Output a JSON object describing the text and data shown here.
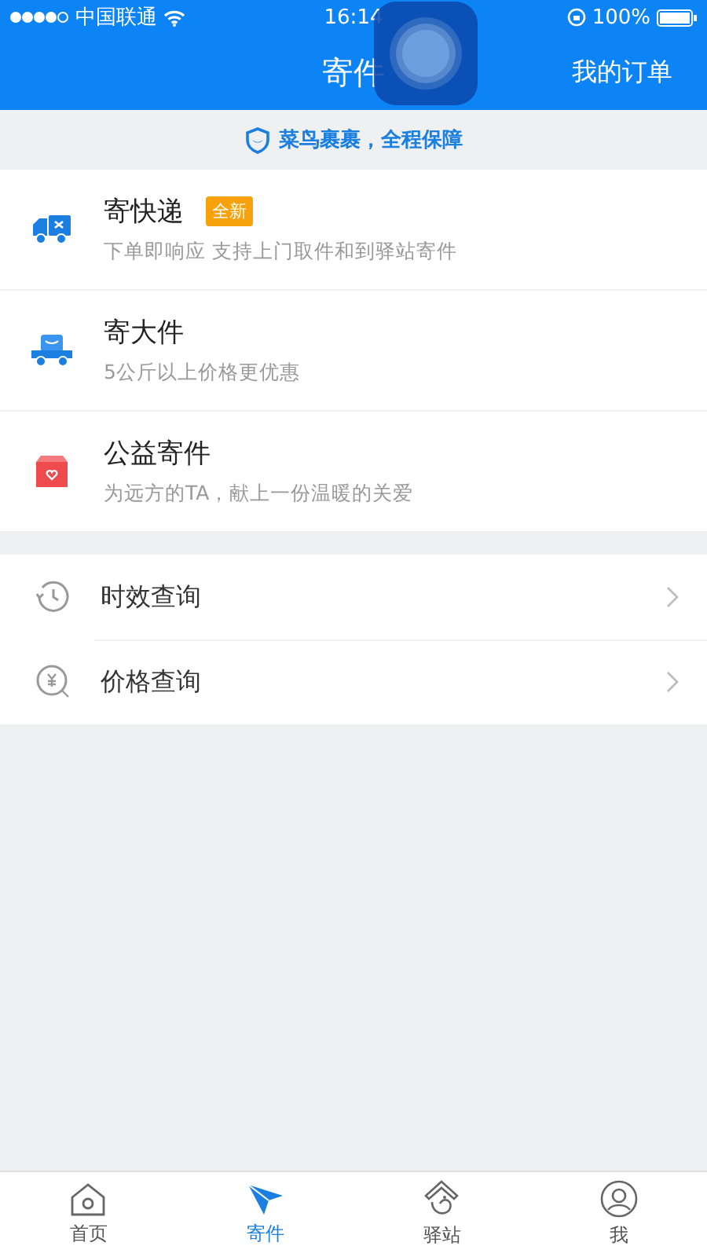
{
  "status_bar": {
    "carrier": "中国联通",
    "time": "16:14",
    "battery": "100%"
  },
  "nav_bar": {
    "title": "寄件",
    "action": "我的订单"
  },
  "banner": {
    "text": "菜鸟裹裹，全程保障"
  },
  "services": [
    {
      "kind": "express",
      "title": "寄快递",
      "badge": "全新",
      "subtitle": "下单即响应 支持上门取件和到驿站寄件"
    },
    {
      "kind": "bulky",
      "title": "寄大件",
      "subtitle": "5公斤以上价格更优惠"
    },
    {
      "kind": "charity",
      "title": "公益寄件",
      "subtitle": "为远方的TA，献上一份温暖的关爱"
    }
  ],
  "queries": [
    {
      "kind": "time",
      "label": "时效查询"
    },
    {
      "kind": "price",
      "label": "价格查询"
    }
  ],
  "tab_bar": [
    {
      "kind": "home",
      "label": "首页",
      "selected": false
    },
    {
      "kind": "send",
      "label": "寄件",
      "selected": true
    },
    {
      "kind": "station",
      "label": "驿站",
      "selected": false
    },
    {
      "kind": "me",
      "label": "我",
      "selected": false
    }
  ]
}
